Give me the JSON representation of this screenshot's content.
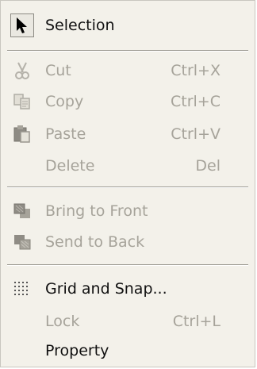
{
  "menu": {
    "selection": {
      "label": "Selection",
      "icon": "arrow-cursor-icon"
    },
    "cut": {
      "label": "Cut",
      "shortcut": "Ctrl+X",
      "icon": "scissors-icon"
    },
    "copy": {
      "label": "Copy",
      "shortcut": "Ctrl+C",
      "icon": "copy-icon"
    },
    "paste": {
      "label": "Paste",
      "shortcut": "Ctrl+V",
      "icon": "paste-icon"
    },
    "delete": {
      "label": "Delete",
      "shortcut": "Del"
    },
    "bring_front": {
      "label": "Bring to Front",
      "icon": "bring-to-front-icon"
    },
    "send_back": {
      "label": "Send to Back",
      "icon": "send-to-back-icon"
    },
    "grid_snap": {
      "label": "Grid and Snap...",
      "icon": "grid-icon"
    },
    "lock": {
      "label": "Lock",
      "shortcut": "Ctrl+L"
    },
    "property": {
      "label": "Property"
    }
  },
  "colors": {
    "menu_bg": "#f3f1ea",
    "disabled_text": "#a6a39a",
    "text": "#111111"
  }
}
